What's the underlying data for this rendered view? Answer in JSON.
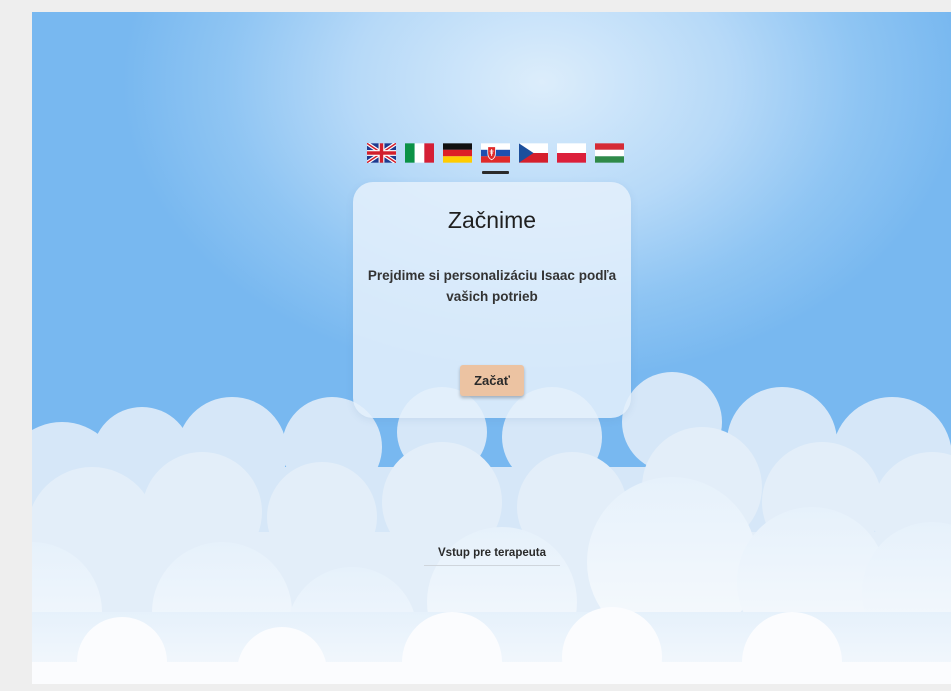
{
  "languages": [
    {
      "name": "English",
      "icon": "uk-flag-icon"
    },
    {
      "name": "Italiano",
      "icon": "italy-flag-icon"
    },
    {
      "name": "Deutsch",
      "icon": "germany-flag-icon"
    },
    {
      "name": "Slovenčina",
      "icon": "slovakia-flag-icon",
      "selected": true
    },
    {
      "name": "Čeština",
      "icon": "czech-flag-icon"
    },
    {
      "name": "Polski",
      "icon": "poland-flag-icon"
    },
    {
      "name": "Magyar",
      "icon": "hungary-flag-icon"
    }
  ],
  "card": {
    "title": "Začnime",
    "description": "Prejdime si personalizáciu Isaac podľa vašich potrieb",
    "start_button": "Začať"
  },
  "therapist_link": "Vstup pre terapeuta",
  "colors": {
    "sky_top": "#dcedfb",
    "sky_edge": "#78b8f0",
    "button": "#ecc3a2",
    "card": "#e4f0fb"
  }
}
